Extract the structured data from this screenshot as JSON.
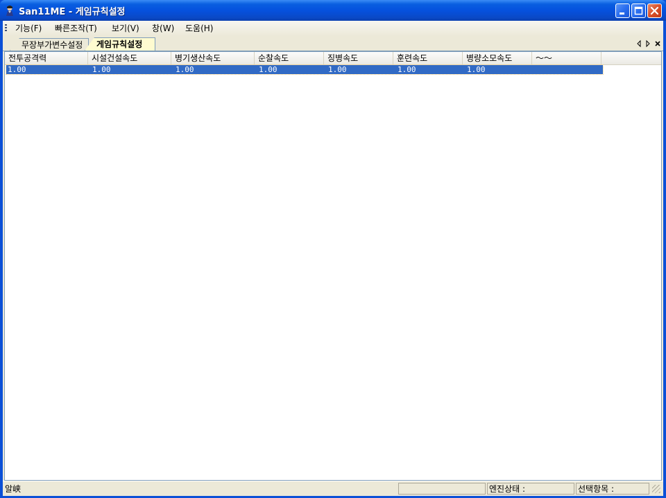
{
  "window": {
    "title": "San11ME - 게임규칙설정",
    "colors": {
      "title_bar": "#0551de",
      "selection": "#316ac5",
      "active_tab": "#fffbd0"
    }
  },
  "menu": {
    "items": [
      {
        "label": "기능(F)"
      },
      {
        "label": "빠른조작(T)"
      },
      {
        "label": "보기(V)"
      },
      {
        "label": "창(W)"
      },
      {
        "label": "도움(H)"
      }
    ]
  },
  "tabs": {
    "items": [
      {
        "label": "무장부가변수설정",
        "active": false
      },
      {
        "label": "게임규칙설정",
        "active": true
      }
    ],
    "controls": {
      "prev_icon": "triangle-left-icon",
      "next_icon": "triangle-right-icon",
      "close_icon": "close-icon"
    }
  },
  "table": {
    "columns": [
      "전투공격력",
      "시설건설속도",
      "병기생산속도",
      "순찰속도",
      "징병속도",
      "훈련속도",
      "병량소모속도",
      "～～"
    ],
    "rows": [
      [
        "1.00",
        "1.00",
        "1.00",
        "1.00",
        "1.00",
        "1.00",
        "1.00",
        ""
      ]
    ]
  },
  "statusbar": {
    "message": "알峡",
    "engine_label": "엔진상태 :",
    "selection_label": "선택항목 :"
  }
}
